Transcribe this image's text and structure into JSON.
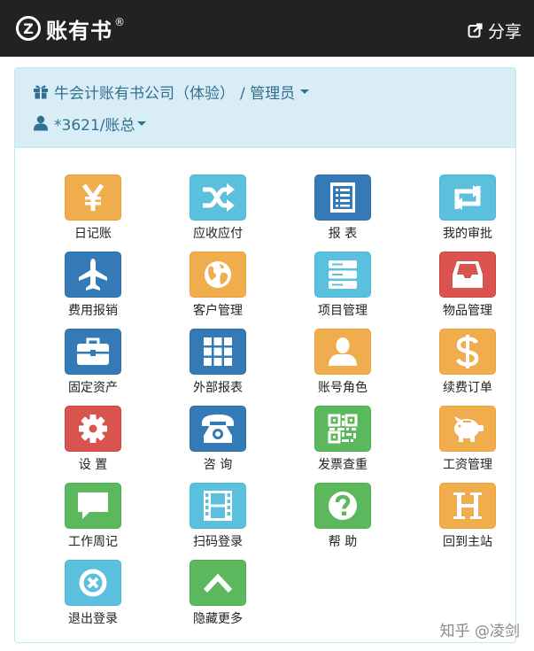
{
  "header": {
    "brand": "账有书",
    "brand_mark": "Z",
    "registered": "®",
    "share_label": "分享"
  },
  "panel": {
    "company": "牛会计账有书公司（体验）",
    "role": "/ 管理员",
    "account": "*3621/账总"
  },
  "tiles": [
    {
      "label": "日记账",
      "icon": "yen-icon",
      "color": "#f0ad4e"
    },
    {
      "label": "应收应付",
      "icon": "shuffle-icon",
      "color": "#5bc0de"
    },
    {
      "label": "报 表",
      "icon": "report-list-icon",
      "color": "#337ab7"
    },
    {
      "label": "我的审批",
      "icon": "retweet-icon",
      "color": "#5bc0de"
    },
    {
      "label": "费用报销",
      "icon": "plane-icon",
      "color": "#337ab7"
    },
    {
      "label": "客户管理",
      "icon": "globe-icon",
      "color": "#f0ad4e"
    },
    {
      "label": "项目管理",
      "icon": "server-icon",
      "color": "#5bc0de"
    },
    {
      "label": "物品管理",
      "icon": "inbox-icon",
      "color": "#d9534f"
    },
    {
      "label": "固定资产",
      "icon": "briefcase-icon",
      "color": "#337ab7"
    },
    {
      "label": "外部报表",
      "icon": "grid-icon",
      "color": "#337ab7"
    },
    {
      "label": "账号角色",
      "icon": "user-icon",
      "color": "#f0ad4e"
    },
    {
      "label": "续费订单",
      "icon": "dollar-icon",
      "color": "#f0ad4e"
    },
    {
      "label": "设 置",
      "icon": "gear-icon",
      "color": "#d9534f"
    },
    {
      "label": "咨 询",
      "icon": "phone-icon",
      "color": "#337ab7"
    },
    {
      "label": "发票查重",
      "icon": "qrcode-icon",
      "color": "#5cb85c"
    },
    {
      "label": "工资管理",
      "icon": "piggy-bank-icon",
      "color": "#f0ad4e"
    },
    {
      "label": "工作周记",
      "icon": "comment-icon",
      "color": "#5cb85c"
    },
    {
      "label": "扫码登录",
      "icon": "film-icon",
      "color": "#5bc0de"
    },
    {
      "label": "帮 助",
      "icon": "question-icon",
      "color": "#5cb85c"
    },
    {
      "label": "回到主站",
      "icon": "header-h-icon",
      "color": "#f0ad4e"
    },
    {
      "label": "退出登录",
      "icon": "remove-circle-icon",
      "color": "#5bc0de"
    },
    {
      "label": "隐藏更多",
      "icon": "chevron-up-icon",
      "color": "#5cb85c"
    }
  ],
  "watermark": "知乎 @凌剑"
}
